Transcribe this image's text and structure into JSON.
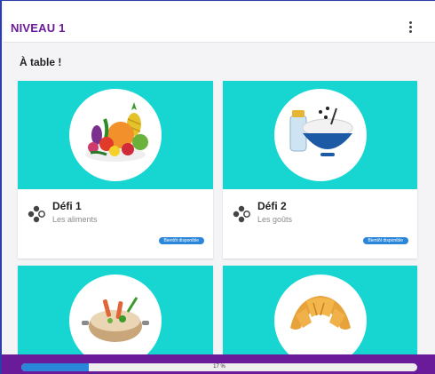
{
  "header": {
    "title": "NIVEAU 1",
    "menu_icon": "kebab-menu-icon"
  },
  "section": {
    "title": "À table !"
  },
  "cards": [
    {
      "title": "Défi 1",
      "subtitle": "Les aliments",
      "button": "Bientôt disponible",
      "image": "vegetables-fruits-basket"
    },
    {
      "title": "Défi 2",
      "subtitle": "Les goûts",
      "button": "Bientôt disponible",
      "image": "sugar-salt-bowl"
    },
    {
      "title": "",
      "subtitle": "",
      "button": "",
      "image": "cooking-pot"
    },
    {
      "title": "",
      "subtitle": "",
      "button": "",
      "image": "croissant"
    }
  ],
  "progress": {
    "value": 0.17,
    "label": "17 %"
  },
  "colors": {
    "accent": "#6a1b9a",
    "card_media": "#17d6d2",
    "button": "#2a86d8"
  }
}
